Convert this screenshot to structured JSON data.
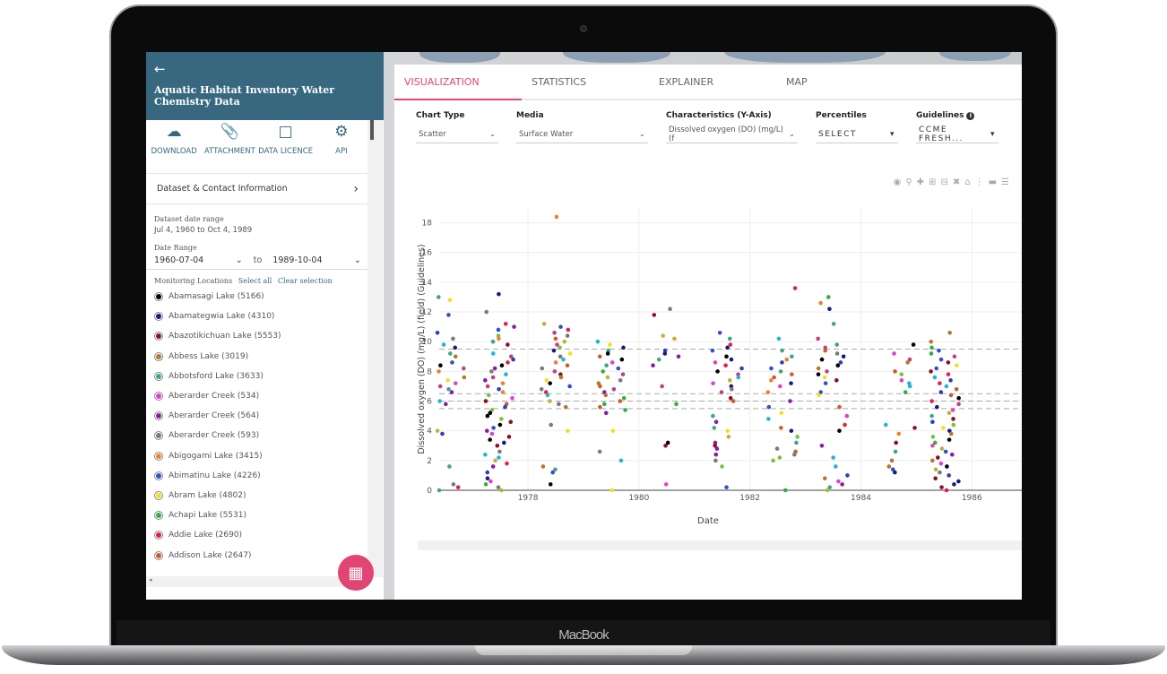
{
  "device": {
    "brand": "MacBook"
  },
  "sidebar": {
    "title": "Aquatic Habitat Inventory Water Chemistry Data",
    "actions": [
      {
        "label": "DOWNLOAD",
        "icon": "cloud-download-icon"
      },
      {
        "label": "ATTACHMENT",
        "icon": "paperclip-icon"
      },
      {
        "label": "DATA LICENCE",
        "icon": "document-icon"
      },
      {
        "label": "API",
        "icon": "gear-icon"
      }
    ],
    "dataset_contact": "Dataset & Contact Information",
    "dataset_range_label": "Dataset date range",
    "dataset_range_value": "Jul 4, 1960 to Oct 4, 1989",
    "date_range_label": "Date Range",
    "date_from": "1960-07-04",
    "date_to_label": "to",
    "date_to": "1989-10-04",
    "locations_label": "Monitoring Locations",
    "select_all": "Select all",
    "clear_selection": "Clear selection",
    "locations": [
      {
        "name": "Abamasagi Lake (5166)",
        "color": "#000000"
      },
      {
        "name": "Abamategwia Lake (4310)",
        "color": "#1a1a80"
      },
      {
        "name": "Abazotikichuan Lake (5553)",
        "color": "#8b1020"
      },
      {
        "name": "Abbess Lake (3019)",
        "color": "#b07a2a"
      },
      {
        "name": "Abbotsford Lake (3633)",
        "color": "#3fa58a"
      },
      {
        "name": "Aberarder Creek (534)",
        "color": "#e040d0"
      },
      {
        "name": "Aberarder Creek (564)",
        "color": "#8a1aa8"
      },
      {
        "name": "Aberarder Creek (593)",
        "color": "#7a7a7a"
      },
      {
        "name": "Abigogami Lake (3415)",
        "color": "#f08030"
      },
      {
        "name": "Abimatinu Lake (4226)",
        "color": "#3050c8"
      },
      {
        "name": "Abram Lake (4802)",
        "color": "#f0e020"
      },
      {
        "name": "Achapi Lake (5531)",
        "color": "#30b040"
      },
      {
        "name": "Addie Lake (2690)",
        "color": "#e0204a"
      },
      {
        "name": "Addison Lake (2647)",
        "color": "#d05a2a"
      }
    ]
  },
  "tabs": [
    {
      "label": "VISUALIZATION",
      "active": true
    },
    {
      "label": "STATISTICS",
      "active": false
    },
    {
      "label": "EXPLAINER",
      "active": false
    },
    {
      "label": "MAP",
      "active": false
    }
  ],
  "controls": {
    "chart_type": {
      "label": "Chart Type",
      "value": "Scatter"
    },
    "media": {
      "label": "Media",
      "value": "Surface Water"
    },
    "characteristics": {
      "label": "Characteristics (Y-Axis)",
      "value": "Dissolved oxygen (DO) (mg/L) (f"
    },
    "percentiles": {
      "label": "Percentiles",
      "value": "SELECT"
    },
    "guidelines": {
      "label": "Guidelines",
      "value": "CCME FRESH..."
    }
  },
  "modebar": [
    "camera-icon",
    "zoom-icon",
    "pan-icon",
    "zoom-in-icon",
    "zoom-out-icon",
    "autoscale-icon",
    "home-icon",
    "spike-icon",
    "hover-closest-icon",
    "hover-compare-icon"
  ],
  "chart_data": {
    "type": "scatter",
    "title": "",
    "xlabel": "Date",
    "ylabel": "Dissolved oxygen (DO) (mg/L) (field) (Guidelines)",
    "xlim": [
      1976.4,
      1986.9
    ],
    "ylim": [
      0,
      19
    ],
    "x_ticks": [
      "1978",
      "1980",
      "1982",
      "1984",
      "1986"
    ],
    "y_ticks": [
      "0",
      "2",
      "4",
      "6",
      "8",
      "10",
      "12",
      "14",
      "16",
      "18"
    ],
    "grid": true,
    "guidelines": [
      9.5,
      6.5,
      6.0,
      5.5
    ],
    "clusters": [
      {
        "x": 1976.6,
        "values": [
          12.8,
          13.0,
          11.8,
          10.6,
          10.2,
          9.8,
          9.6,
          9.2,
          9.0,
          8.6,
          8.4,
          8.2,
          8.0,
          7.6,
          7.4,
          7.2,
          7.0,
          6.8,
          6.6,
          6.0,
          5.8,
          4.0,
          3.8,
          1.6,
          0.4,
          0.2,
          0.0
        ]
      },
      {
        "x": 1977.5,
        "values": [
          13.2,
          12.0,
          11.2,
          11.0,
          10.8,
          10.4,
          10.2,
          10.0,
          9.8,
          9.2,
          9.0,
          8.8,
          8.6,
          8.4,
          8.2,
          8.0,
          7.8,
          7.6,
          7.4,
          7.2,
          7.0,
          6.8,
          6.6,
          6.4,
          6.2,
          6.0,
          5.8,
          5.6,
          5.4,
          5.2,
          5.0,
          4.8,
          4.6,
          4.4,
          4.2,
          4.0,
          3.8,
          3.6,
          3.4,
          3.2,
          3.0,
          2.6,
          2.4,
          2.2,
          2.0,
          1.8,
          1.6,
          1.2,
          0.8,
          0.6,
          0.4,
          0.2,
          0.0
        ]
      },
      {
        "x": 1978.5,
        "values": [
          18.4,
          11.2,
          11.0,
          10.8,
          10.6,
          10.4,
          10.2,
          10.0,
          9.8,
          9.6,
          9.4,
          9.2,
          9.0,
          8.8,
          8.6,
          8.4,
          8.2,
          8.0,
          7.8,
          7.6,
          7.4,
          7.2,
          7.0,
          6.8,
          6.6,
          6.4,
          6.0,
          5.8,
          5.6,
          4.4,
          4.0,
          1.6,
          1.4,
          1.2,
          0.4
        ]
      },
      {
        "x": 1979.5,
        "values": [
          10.0,
          9.8,
          9.6,
          9.4,
          9.2,
          9.0,
          8.8,
          8.6,
          8.4,
          8.2,
          8.0,
          7.8,
          7.6,
          7.4,
          7.2,
          7.0,
          6.8,
          6.6,
          6.4,
          6.2,
          6.0,
          5.8,
          5.6,
          5.4,
          5.2,
          4.0,
          2.6,
          2.0,
          0.0
        ]
      },
      {
        "x": 1980.5,
        "values": [
          12.2,
          11.8,
          10.4,
          10.2,
          9.4,
          9.2,
          9.0,
          8.8,
          8.4,
          7.0,
          5.8,
          3.2,
          3.0,
          0.4
        ]
      },
      {
        "x": 1981.6,
        "values": [
          10.6,
          10.2,
          9.8,
          9.6,
          9.4,
          9.0,
          8.8,
          8.6,
          8.4,
          8.2,
          8.0,
          7.8,
          7.6,
          7.4,
          7.2,
          7.0,
          6.8,
          6.6,
          6.2,
          6.0,
          5.0,
          4.6,
          4.2,
          4.0,
          3.6,
          3.2,
          3.0,
          2.8,
          2.4,
          2.0,
          1.6,
          0.2
        ]
      },
      {
        "x": 1982.6,
        "values": [
          13.6,
          10.2,
          9.4,
          9.0,
          8.8,
          8.6,
          8.2,
          8.0,
          7.8,
          7.6,
          7.4,
          7.2,
          7.0,
          6.6,
          6.0,
          5.6,
          5.2,
          4.8,
          4.2,
          4.0,
          3.6,
          3.2,
          2.8,
          2.6,
          2.4,
          2.2,
          2.0,
          0.0
        ]
      },
      {
        "x": 1983.5,
        "values": [
          13.0,
          12.6,
          12.2,
          11.2,
          10.2,
          9.8,
          9.6,
          9.4,
          9.2,
          9.0,
          8.8,
          8.6,
          8.4,
          8.2,
          8.0,
          7.8,
          7.6,
          7.4,
          7.2,
          6.6,
          6.4,
          5.6,
          5.0,
          4.4,
          4.0,
          3.0,
          2.2,
          1.6,
          1.0,
          0.8,
          0.6,
          0.4,
          0.2,
          0.0
        ]
      },
      {
        "x": 1984.7,
        "values": [
          9.8,
          9.2,
          8.8,
          8.6,
          8.0,
          7.8,
          7.4,
          7.2,
          7.0,
          6.6,
          4.4,
          4.2,
          3.8,
          3.2,
          2.6,
          2.0,
          1.6,
          1.4,
          1.2
        ]
      },
      {
        "x": 1985.5,
        "values": [
          10.6,
          10.0,
          9.6,
          9.4,
          9.2,
          9.0,
          8.8,
          8.6,
          8.4,
          8.2,
          8.0,
          7.8,
          7.6,
          7.4,
          7.2,
          7.0,
          6.8,
          6.6,
          6.4,
          6.2,
          6.0,
          5.8,
          5.6,
          5.4,
          5.2,
          5.0,
          4.8,
          4.6,
          4.4,
          4.2,
          4.0,
          3.8,
          3.6,
          3.4,
          3.2,
          3.0,
          2.8,
          2.6,
          2.4,
          2.2,
          2.0,
          1.8,
          1.6,
          1.4,
          1.2,
          1.0,
          0.8,
          0.6,
          0.4,
          0.2,
          0.0
        ]
      }
    ]
  }
}
